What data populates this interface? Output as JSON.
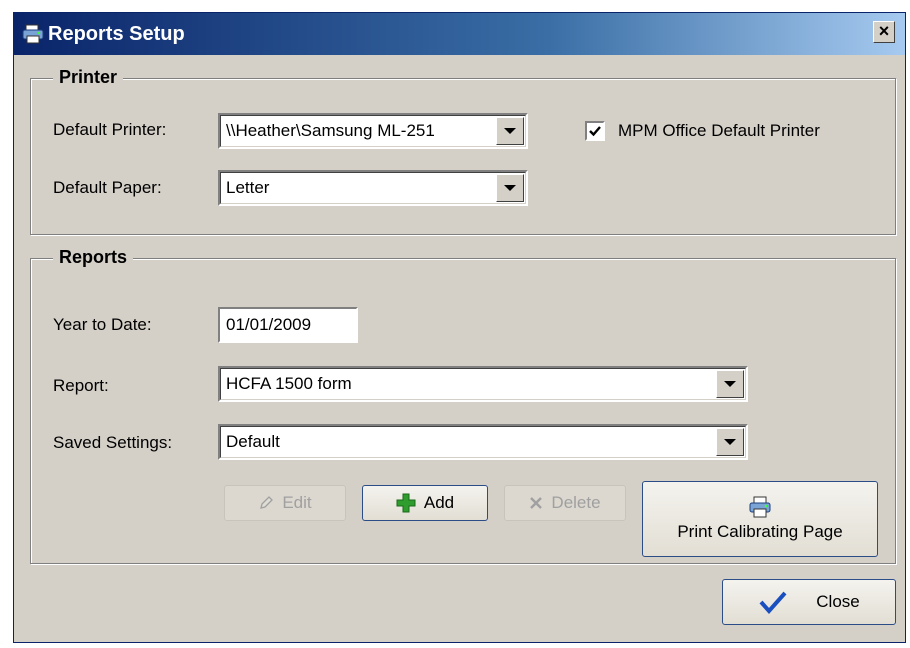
{
  "window": {
    "title": "Reports Setup"
  },
  "printer_group": {
    "legend": "Printer",
    "default_printer_label": "Default Printer:",
    "default_printer_value": "\\\\Heather\\Samsung ML-251",
    "default_paper_label": "Default Paper:",
    "default_paper_value": "Letter",
    "office_default_label": "MPM Office Default Printer",
    "office_default_checked": true
  },
  "reports_group": {
    "legend": "Reports",
    "ytd_label": "Year to Date:",
    "ytd_value": "01/01/2009",
    "report_label": "Report:",
    "report_value": "HCFA 1500 form",
    "saved_settings_label": "Saved Settings:",
    "saved_settings_value": "Default",
    "edit_label": "Edit",
    "add_label": "Add",
    "delete_label": "Delete",
    "print_calibrating_label": "Print Calibrating Page"
  },
  "footer": {
    "close_label": "Close"
  },
  "colors": {
    "title_gradient_start": "#0a246a",
    "window_bg": "#d4d0c8",
    "add_icon": "#2e9d2e",
    "close_check": "#1a4fbf"
  }
}
